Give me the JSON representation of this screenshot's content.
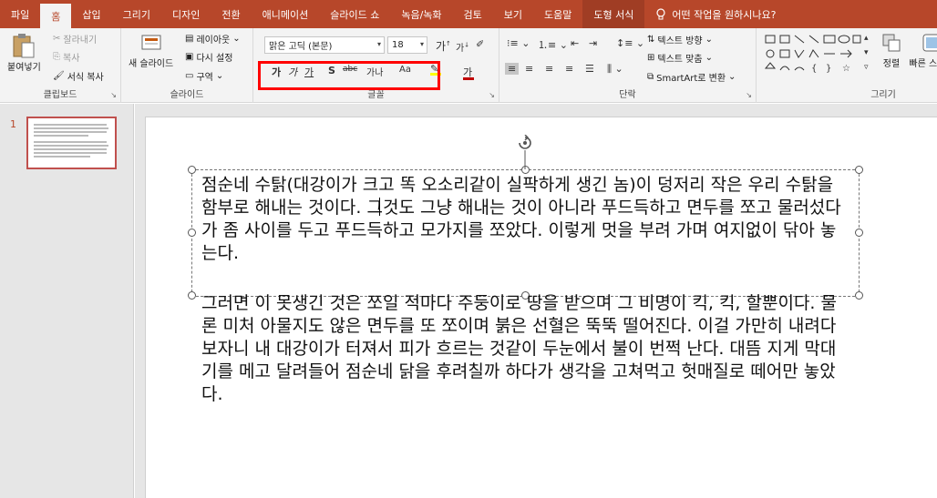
{
  "tabs": [
    {
      "label": "파일",
      "active": false
    },
    {
      "label": "홈",
      "active": true
    },
    {
      "label": "삽입",
      "active": false
    },
    {
      "label": "그리기",
      "active": false
    },
    {
      "label": "디자인",
      "active": false
    },
    {
      "label": "전환",
      "active": false
    },
    {
      "label": "애니메이션",
      "active": false
    },
    {
      "label": "슬라이드 쇼",
      "active": false
    },
    {
      "label": "녹음/녹화",
      "active": false
    },
    {
      "label": "검토",
      "active": false
    },
    {
      "label": "보기",
      "active": false
    },
    {
      "label": "도움말",
      "active": false
    },
    {
      "label": "도형 서식",
      "active": false,
      "contextual": true
    }
  ],
  "tell_me": "어떤 작업을 원하시나요?",
  "clipboard": {
    "paste": "붙여넣기",
    "cut": "잘라내기",
    "copy": "복사",
    "format_painter": "서식 복사",
    "label": "클립보드"
  },
  "slides_group": {
    "new_slide": "새 슬라이드",
    "layout": "레이아웃",
    "reset": "다시 설정",
    "section": "구역",
    "label": "슬라이드"
  },
  "font_group": {
    "font_name": "맑은 고딕 (본문)",
    "font_size": "18",
    "bold": "가",
    "italic": "가",
    "underline": "가",
    "strike": "S",
    "shadow": "abc",
    "spacing": "가나",
    "case": "Aa",
    "grow": "가",
    "shrink": "가",
    "label": "글꼴"
  },
  "paragraph_group": {
    "text_direction": "텍스트 방향",
    "align_text": "텍스트 맞춤",
    "smartart": "SmartArt로 변환",
    "label": "단락"
  },
  "drawing_group": {
    "arrange": "정렬",
    "quick_styles": "빠른 스타일",
    "label": "그리기"
  },
  "thumbnail": {
    "number": "1"
  },
  "slide_text": {
    "p1": "점순네 수탉(대강이가 크고 똑 오소리같이 실팍하게 생긴 놈)이 덩저리 작은 우리 수탉을 함부로 해내는 것이다. 그것도 그냥 해내는 것이 아니라 푸드득하고 면두를 쪼고 물러섰다가 좀 사이를 두고 푸드득하고 모가지를 쪼았다. 이렇게 멋을 부려 가며 여지없이 닦아 놓는다.",
    "p2": "그러면 이 못생긴 것은 쪼일 적마다 주둥이로 땅을 받으며 그 비명이 킥, 킥, 할뿐이다. 물론 미처 아물지도 않은 면두를 또 쪼이며 붉은 선혈은 뚝뚝 떨어진다. 이걸 가만히 내려다보자니 내 대강이가 터져서 피가 흐르는 것같이 두눈에서 불이 번쩍 난다. 대뜸 지게 막대기를 메고 달려들어 점순네 닭을 후려칠까 하다가 생각을 고쳐먹고 헛매질로 떼어만 놓았다."
  },
  "colors": {
    "accent": "#b7472a",
    "highlight": "#ff0000",
    "ribbon_bg": "#f3f3f3"
  }
}
